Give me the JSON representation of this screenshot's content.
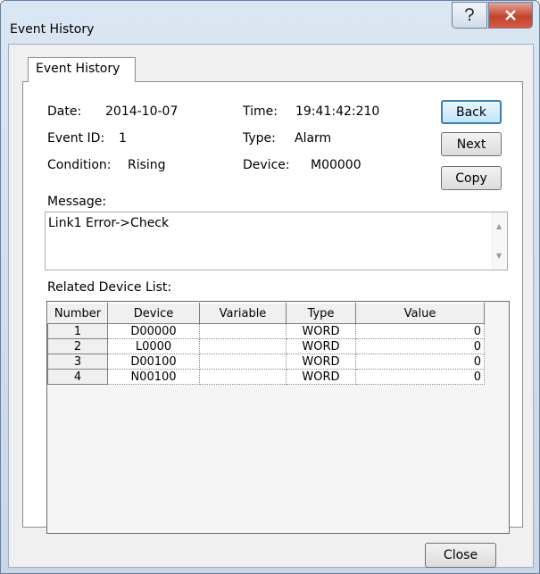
{
  "window": {
    "title": "Event History"
  },
  "tab": {
    "label": "Event History"
  },
  "event": {
    "date_label": "Date:",
    "date_value": "2014-10-07",
    "time_label": "Time:",
    "time_value": "19:41:42:210",
    "id_label": "Event ID:",
    "id_value": "1",
    "type_label": "Type:",
    "type_value": "Alarm",
    "condition_label": "Condition:",
    "condition_value": "Rising",
    "device_label": "Device:",
    "device_value": "M00000"
  },
  "buttons": {
    "back": "Back",
    "next": "Next",
    "copy": "Copy",
    "close": "Close"
  },
  "message": {
    "label": "Message:",
    "text": "Link1 Error->Check"
  },
  "related": {
    "label": "Related Device List:",
    "columns": [
      "Number",
      "Device",
      "Variable",
      "Type",
      "Value"
    ],
    "rows": [
      [
        "1",
        "D00000",
        "",
        "WORD",
        "0"
      ],
      [
        "2",
        "L0000",
        "",
        "WORD",
        "0"
      ],
      [
        "3",
        "D00100",
        "",
        "WORD",
        "0"
      ],
      [
        "4",
        "N00100",
        "",
        "WORD",
        "0"
      ]
    ]
  },
  "icons": {
    "help": "help-icon",
    "close": "close-x-icon"
  },
  "colors": {
    "title_bar": "#c7d7ea",
    "close_button": "#c4432b",
    "default_button_border": "#3c7fb1"
  }
}
